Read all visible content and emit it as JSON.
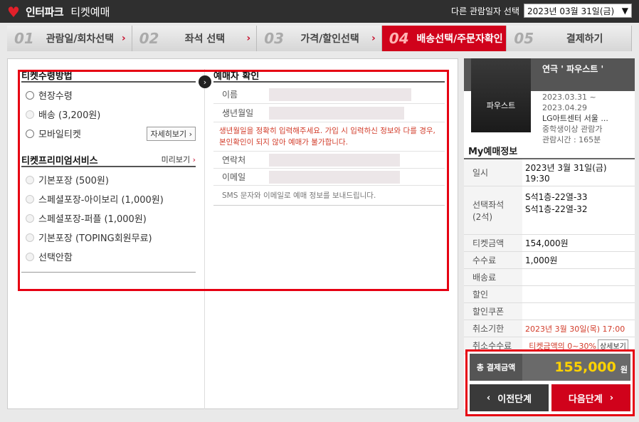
{
  "header": {
    "brand": "인터파크",
    "brand_sub": "티켓예매",
    "date_label": "다른 관람일자 선택",
    "date_value": "2023년 03월 31일(금)"
  },
  "steps": [
    {
      "num": "01",
      "label": "관람일/회차선택"
    },
    {
      "num": "02",
      "label": "좌석 선택"
    },
    {
      "num": "03",
      "label": "가격/할인선택"
    },
    {
      "num": "04",
      "label": "배송선택/주문자확인"
    },
    {
      "num": "05",
      "label": "결제하기"
    }
  ],
  "delivery": {
    "title": "티켓수령방법",
    "options": [
      "현장수령",
      "배송 (3,200원)",
      "모바일티켓"
    ],
    "detail_button": "자세히보기"
  },
  "premium": {
    "title": "티켓프리미엄서비스",
    "preview": "미리보기",
    "options": [
      "기본포장 (500원)",
      "스페셜포장-아이보리 (1,000원)",
      "스페셜포장-퍼플 (1,000원)",
      "기본포장 (TOPING회원무료)",
      "선택안함"
    ]
  },
  "booker": {
    "title": "예매자 확인",
    "name_label": "이름",
    "birth_label": "생년월일",
    "warning": "생년월일을 정확히 입력해주세요. 가입 시 입력하신 정보와 다를 경우, 본인확인이 되지 않아 예매가 불가합니다.",
    "phone_label": "연락처",
    "email_label": "이메일",
    "sms_note": "SMS 문자와 이메일로 예매 정보를 보내드립니다."
  },
  "show": {
    "title": "연극 ' 파우스트 '",
    "poster_text": "파우스트",
    "date_from": "2023.03.31 ~",
    "date_to": "2023.04.29",
    "venue": "LG아트센터 서울 ...",
    "age": "중학생이상 관람가",
    "runtime": "관람시간 : 165분"
  },
  "my_booking": {
    "title": "My예매정보",
    "date_label": "일시",
    "date_value": "2023년 3월 31일(금)",
    "time_value": "19:30",
    "seat_label": "선택좌석",
    "seat_count": "(2석)",
    "seats": [
      "S석1층-22열-33",
      "S석1층-22열-32"
    ],
    "ticket_label": "티켓금액",
    "ticket_value": "154,000원",
    "fee_label": "수수료",
    "fee_value": "1,000원",
    "delivery_label": "배송료",
    "discount_label": "할인",
    "coupon_label": "할인쿠폰",
    "cancel_deadline_label": "취소기한",
    "cancel_deadline_value": "2023년 3월 30일(목) 17:00",
    "cancel_fee_label": "취소수수료",
    "cancel_fee_value": "티켓금액의 0~30%",
    "cancel_fee_button": "상세보기"
  },
  "total": {
    "label": "총 결제금액",
    "amount": "155,000",
    "unit": "원"
  },
  "nav": {
    "prev": "이전단계",
    "next": "다음단계"
  }
}
